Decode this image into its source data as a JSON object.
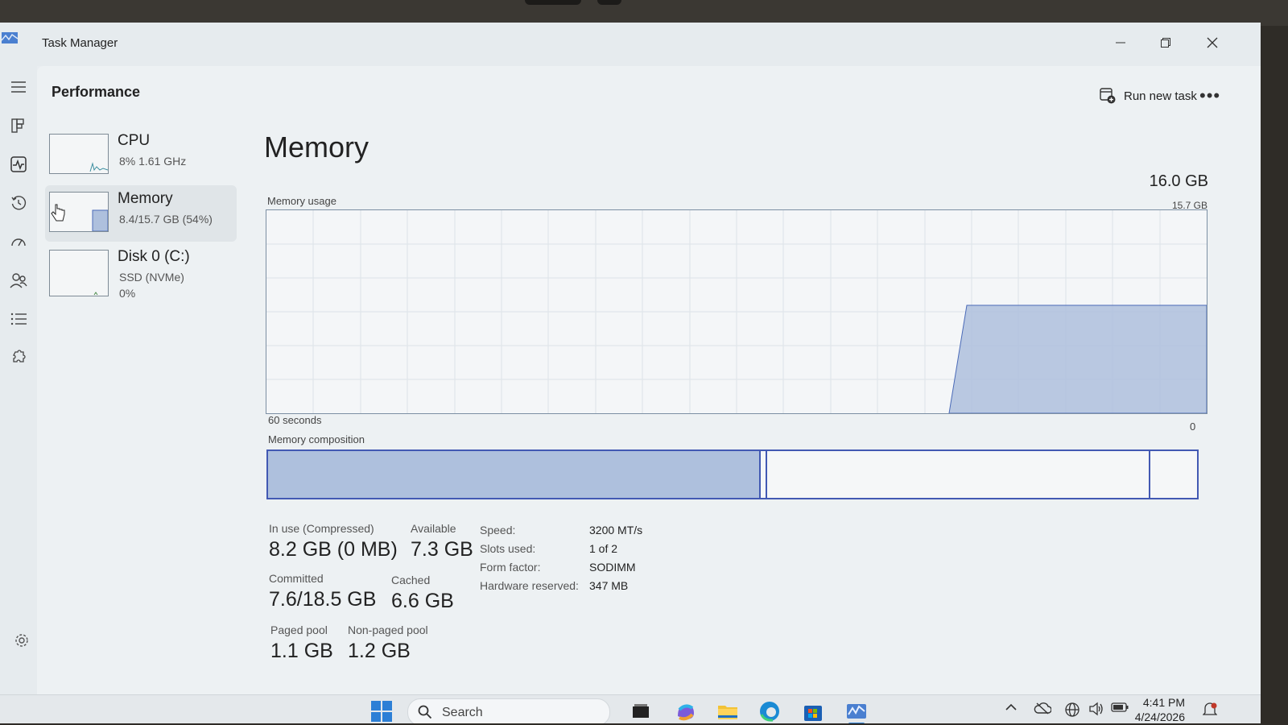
{
  "window": {
    "title": "Task Manager"
  },
  "header": {
    "page_title": "Performance",
    "run_new_task": "Run new task"
  },
  "sidebar": {
    "items": [
      {
        "name": "CPU",
        "sub1": "8%  1.61 GHz",
        "sub2": ""
      },
      {
        "name": "Memory",
        "sub1": "8.4/15.7 GB (54%)",
        "sub2": ""
      },
      {
        "name": "Disk 0 (C:)",
        "sub1": "SSD (NVMe)",
        "sub2": "0%"
      }
    ]
  },
  "memory": {
    "title": "Memory",
    "total": "16.0 GB",
    "usage_label": "Memory usage",
    "usage_max": "15.7 GB",
    "time_span": "60 seconds",
    "time_zero": "0",
    "composition_label": "Memory composition",
    "stats": {
      "in_use_label": "In use (Compressed)",
      "in_use_value": "8.2 GB (0 MB)",
      "available_label": "Available",
      "available_value": "7.3 GB",
      "committed_label": "Committed",
      "committed_value": "7.6/18.5 GB",
      "cached_label": "Cached",
      "cached_value": "6.6 GB",
      "paged_label": "Paged pool",
      "paged_value": "1.1 GB",
      "nonpaged_label": "Non-paged pool",
      "nonpaged_value": "1.2 GB"
    },
    "details": [
      {
        "label": "Speed:",
        "value": "3200 MT/s"
      },
      {
        "label": "Slots used:",
        "value": "1 of 2"
      },
      {
        "label": "Form factor:",
        "value": "SODIMM"
      },
      {
        "label": "Hardware reserved:",
        "value": "347 MB"
      }
    ]
  },
  "taskbar": {
    "search_placeholder": "Search",
    "time": "4:41 PM",
    "date": "4/24/2026"
  },
  "colors": {
    "accent": "#4259b3",
    "fill": "#aec0dd"
  }
}
